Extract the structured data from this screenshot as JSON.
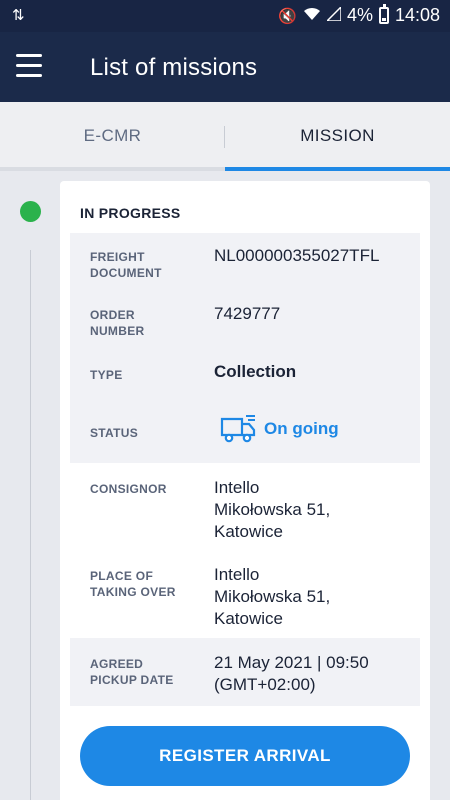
{
  "status_bar": {
    "battery": "4%",
    "time": "14:08"
  },
  "app_bar": {
    "title": "List of missions"
  },
  "tabs": [
    {
      "label": "E-CMR",
      "active": false
    },
    {
      "label": "MISSION",
      "active": true
    }
  ],
  "mission": {
    "heading": "IN PROGRESS",
    "fields": {
      "freight_document": {
        "label": "FREIGHT DOCUMENT",
        "value": "NL000000355027TFL"
      },
      "order_number": {
        "label": "ORDER NUMBER",
        "value": "7429777"
      },
      "type": {
        "label": "TYPE",
        "value": "Collection"
      },
      "status": {
        "label": "STATUS",
        "value": "On going"
      },
      "consignor": {
        "label": "CONSIGNOR",
        "line1": "Intello",
        "line2": "Mikołowska 51,",
        "line3": "Katowice"
      },
      "place_of_taking_over": {
        "label": "PLACE OF TAKING OVER",
        "line1": "Intello",
        "line2": "Mikołowska 51,",
        "line3": "Katowice"
      },
      "agreed_pickup_date": {
        "label": "AGREED PICKUP DATE",
        "line1": "21 May 2021 | 09:50",
        "line2": "(GMT+02:00)"
      }
    },
    "action_label": "REGISTER ARRIVAL"
  },
  "colors": {
    "header": "#1b2a4a",
    "accent": "#1e88e5",
    "status_dot": "#2bb24c"
  }
}
